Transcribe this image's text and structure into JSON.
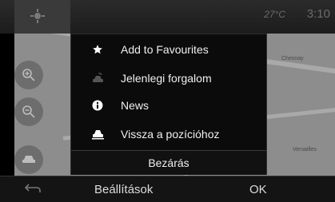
{
  "status": {
    "temperature": "27°C",
    "time": "3:10"
  },
  "map": {
    "place_labels": [
      "Chesnay",
      "Versailles"
    ]
  },
  "menu": {
    "items": [
      {
        "label": "Add to Favourites",
        "icon": "star-icon"
      },
      {
        "label": "Jelenlegi forgalom",
        "icon": "traffic-car-icon"
      },
      {
        "label": "News",
        "icon": "info-icon"
      },
      {
        "label": "Vissza a pozícióhoz",
        "icon": "car-position-icon"
      }
    ],
    "close_label": "Bezárás"
  },
  "bottom_bar": {
    "settings_label": "Beállítások",
    "ok_label": "OK"
  },
  "colors": {
    "menu_bg": "#0b0b0b",
    "map": "#8d8d8d",
    "bar": "#141414"
  }
}
